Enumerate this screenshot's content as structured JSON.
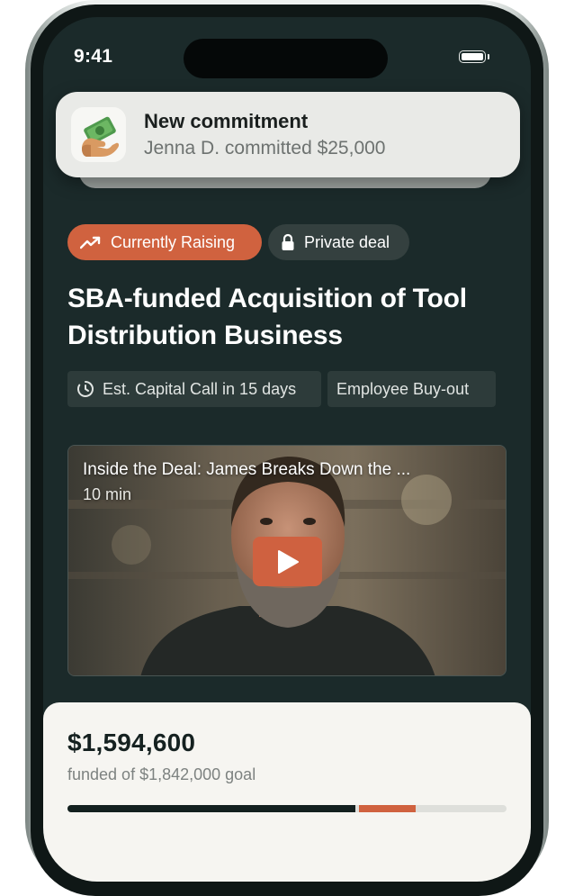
{
  "status_bar": {
    "time": "9:41"
  },
  "notification": {
    "title": "New commitment",
    "body": "Jenna D. committed $25,000",
    "icon": "money-in-hand-icon"
  },
  "badges": [
    {
      "label": "Currently Raising",
      "icon": "trending-up-icon",
      "color": "#d0623f"
    },
    {
      "label": "Private deal",
      "icon": "lock-icon",
      "color": "#34403f"
    }
  ],
  "deal": {
    "title": "SBA-funded Acquisition of Tool Distribution Business",
    "tags": [
      {
        "label": "Est. Capital Call in 15 days",
        "icon": "timer-icon"
      },
      {
        "label": "Employee Buy-out"
      }
    ]
  },
  "video": {
    "title": "Inside the Deal: James Breaks Down the ...",
    "duration": "10 min",
    "play_icon": "play-icon"
  },
  "funding": {
    "amount": "$1,594,600",
    "goal_text": "funded of $1,842,000 goal",
    "funded_fraction": 0.655,
    "pending_fraction": 0.13
  },
  "colors": {
    "background": "#1b2a2a",
    "accent": "#d0623f",
    "card": "#f6f5f1"
  }
}
